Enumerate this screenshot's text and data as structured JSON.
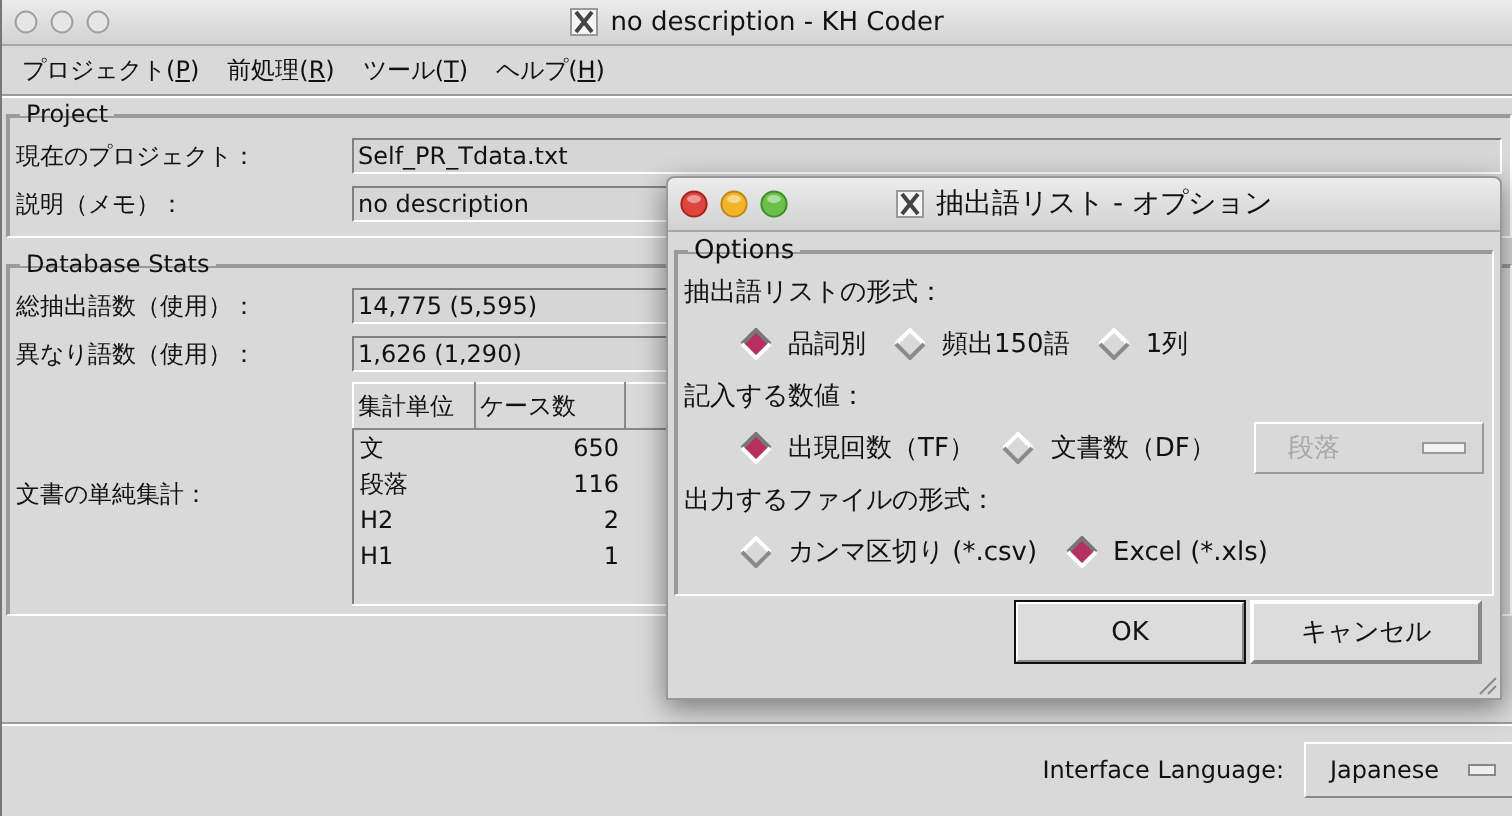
{
  "window": {
    "title": "no description - KH Coder"
  },
  "menu": [
    {
      "before": "プロジェクト(",
      "key": "P",
      "after": ")"
    },
    {
      "before": "前処理(",
      "key": "R",
      "after": ")"
    },
    {
      "before": "ツール(",
      "key": "T",
      "after": ")"
    },
    {
      "before": "ヘルプ(",
      "key": "H",
      "after": ")"
    }
  ],
  "project": {
    "title": "Project",
    "rows": [
      {
        "label": "現在のプロジェクト：",
        "value": "Self_PR_Tdata.txt"
      },
      {
        "label": "説明（メモ）：",
        "value": "no description"
      }
    ]
  },
  "database_stats": {
    "title": "Database Stats",
    "rows": [
      {
        "label": "総抽出語数（使用）：",
        "value": "14,775 (5,595)"
      },
      {
        "label": "異なり語数（使用）：",
        "value": "1,626 (1,290)"
      }
    ],
    "table_label": "文書の単純集計：",
    "table": {
      "columns": [
        "集計単位",
        "ケース数"
      ],
      "rows": [
        [
          "文",
          "650"
        ],
        [
          "段落",
          "116"
        ],
        [
          "H2",
          "2"
        ],
        [
          "H1",
          "1"
        ]
      ]
    }
  },
  "interface_language": {
    "label": "Interface Language:",
    "value": "Japanese"
  },
  "dialog": {
    "title": "抽出語リスト - オプション",
    "group": "Options",
    "sections": [
      {
        "label": "抽出語リストの形式：",
        "options": [
          {
            "label": "品詞別",
            "selected": true
          },
          {
            "label": "頻出150語",
            "selected": false
          },
          {
            "label": "1列",
            "selected": false
          }
        ]
      },
      {
        "label": "記入する数値：",
        "options": [
          {
            "label": "出現回数（TF）",
            "selected": true
          },
          {
            "label": "文書数（DF）",
            "selected": false
          }
        ],
        "dropdown": {
          "value": "段落",
          "disabled": true
        }
      },
      {
        "label": "出力するファイルの形式：",
        "options": [
          {
            "label": "カンマ区切り (*.csv)",
            "selected": false
          },
          {
            "label": "Excel (*.xls)",
            "selected": true
          }
        ]
      }
    ],
    "buttons": [
      {
        "label": "OK",
        "default": true
      },
      {
        "label": "キャンセル",
        "default": false
      }
    ]
  }
}
